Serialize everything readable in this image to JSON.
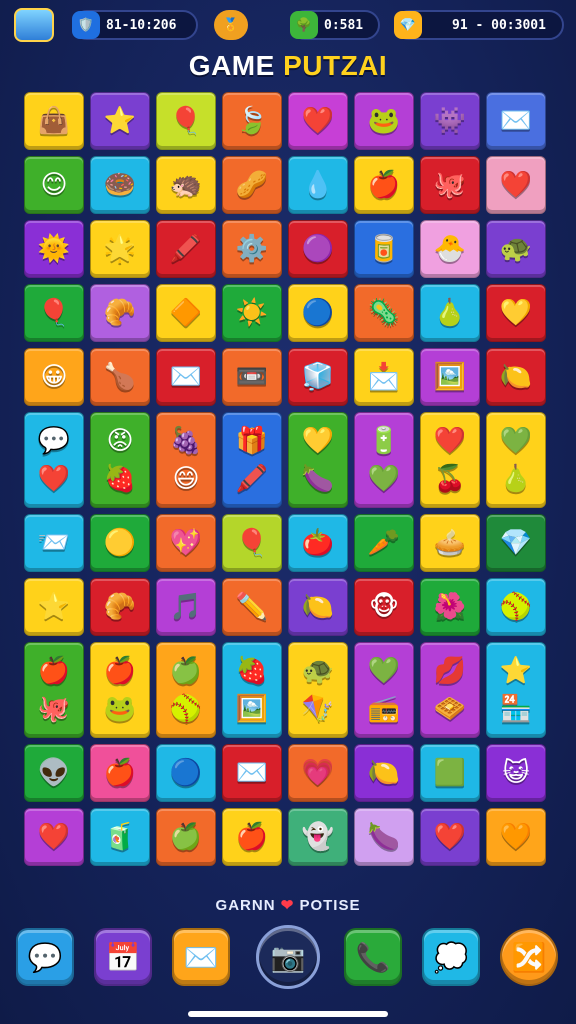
{
  "topbar": {
    "logo_text": "",
    "stat1": {
      "icon": "shield-icon",
      "value": "81-10:206",
      "color": "#1f6fe0"
    },
    "stat2": {
      "icon": "badge-icon",
      "color": "#f0a020"
    },
    "stat3": {
      "icon": "bush-icon",
      "value": "0:581",
      "color": "#3db53a"
    },
    "stat4": {
      "icon": "gem-icon",
      "value": "91 - 00:3001",
      "color": "#ffb31a"
    }
  },
  "title": {
    "word1": "GAME",
    "word2": "PUTZAI"
  },
  "grid": {
    "rows": [
      [
        {
          "c": "#ffd21a",
          "g": "👜",
          "n": "bag-icon"
        },
        {
          "c": "#7a3fd0",
          "g": "⭐",
          "n": "star-icon"
        },
        {
          "c": "#c6e02a",
          "g": "🎈",
          "n": "balloon-icon"
        },
        {
          "c": "#f26a2a",
          "g": "🍃",
          "n": "leaf-icon"
        },
        {
          "c": "#c73fd6",
          "g": "❤️",
          "n": "heart-icon"
        },
        {
          "c": "#b43fd6",
          "g": "🐸",
          "n": "frog-icon"
        },
        {
          "c": "#7a3fd0",
          "g": "👾",
          "n": "monster-icon"
        },
        {
          "c": "#4a6fe0",
          "g": "✉️",
          "n": "envelope-icon"
        }
      ],
      [
        {
          "c": "#3fb02a",
          "g": "😊",
          "n": "smiley-icon"
        },
        {
          "c": "#1fb8e6",
          "g": "🍩",
          "n": "donut-icon"
        },
        {
          "c": "#ffd21a",
          "g": "🦔",
          "n": "spiky-icon"
        },
        {
          "c": "#f26a2a",
          "g": "🥜",
          "n": "peanut-icon"
        },
        {
          "c": "#1fb8e6",
          "g": "💧",
          "n": "drop-icon"
        },
        {
          "c": "#ffd21a",
          "g": "🍎",
          "n": "apple-icon"
        },
        {
          "c": "#d81f2a",
          "g": "🐙",
          "n": "octopus-icon"
        },
        {
          "c": "#f0a0c0",
          "g": "❤️",
          "n": "heart-icon"
        }
      ],
      [
        {
          "c": "#8a2fd6",
          "g": "🌞",
          "n": "sun-icon"
        },
        {
          "c": "#ffd21a",
          "g": "🌟",
          "n": "sunflower-icon"
        },
        {
          "c": "#d81f2a",
          "g": "🖍️",
          "n": "crayon-icon"
        },
        {
          "c": "#f26a2a",
          "g": "⚙️",
          "n": "gear-icon"
        },
        {
          "c": "#d81f2a",
          "g": "🟣",
          "n": "purple-ball-icon"
        },
        {
          "c": "#2a6fe0",
          "g": "🥫",
          "n": "jar-icon"
        },
        {
          "c": "#f0a0e0",
          "g": "🐣",
          "n": "chick-icon"
        },
        {
          "c": "#7a3fd0",
          "g": "🐢",
          "n": "turtle-icon"
        }
      ],
      [
        {
          "c": "#1faa3a",
          "g": "🎈",
          "n": "balloon-icon"
        },
        {
          "c": "#b060e0",
          "g": "🥐",
          "n": "croissant-icon"
        },
        {
          "c": "#ffd21a",
          "g": "🔶",
          "n": "diamond-icon"
        },
        {
          "c": "#1faa3a",
          "g": "☀️",
          "n": "sun-icon"
        },
        {
          "c": "#ffd21a",
          "g": "🔵",
          "n": "blue-ball-icon"
        },
        {
          "c": "#f26a2a",
          "g": "🦠",
          "n": "germ-icon"
        },
        {
          "c": "#1fb8e6",
          "g": "🍐",
          "n": "pear-icon"
        },
        {
          "c": "#d81f2a",
          "g": "💛",
          "n": "heart-icon"
        }
      ],
      [
        {
          "c": "#ffa51a",
          "g": "😀",
          "n": "smiley-icon"
        },
        {
          "c": "#f26a2a",
          "g": "🍗",
          "n": "drumstick-icon"
        },
        {
          "c": "#d81f2a",
          "g": "✉️",
          "n": "envelope-icon"
        },
        {
          "c": "#f26a2a",
          "g": "📼",
          "n": "tape-icon"
        },
        {
          "c": "#d81f2a",
          "g": "🧊",
          "n": "cube-icon"
        },
        {
          "c": "#ffd21a",
          "g": "📩",
          "n": "envelope-icon"
        },
        {
          "c": "#b43fd6",
          "g": "🖼️",
          "n": "picture-icon"
        },
        {
          "c": "#d81f2a",
          "g": "🍋",
          "n": "lemon-icon"
        }
      ]
    ],
    "tall_row": [
      {
        "c": "#1fb8e6",
        "g": [
          "💬",
          "❤️"
        ],
        "n": "speech-heart-tile"
      },
      {
        "c": "#3fb02a",
        "g": [
          "😡",
          "🍓"
        ],
        "n": "face-strawberry-tile"
      },
      {
        "c": "#f26a2a",
        "g": [
          "🍇",
          "😄"
        ],
        "n": "grape-sun-tile"
      },
      {
        "c": "#2a6fe0",
        "g": [
          "🎁",
          "🖍️"
        ],
        "n": "gift-crayon-tile"
      },
      {
        "c": "#3fb02a",
        "g": [
          "💛",
          "🍆"
        ],
        "n": "heart-eggplant-tile"
      },
      {
        "c": "#b43fd6",
        "g": [
          "🔋",
          "💚"
        ],
        "n": "battery-disc-tile"
      },
      {
        "c": "#ffd21a",
        "g": [
          "❤️",
          "🍒"
        ],
        "n": "heart-cherry-tile"
      },
      {
        "c": "#ffd21a",
        "g": [
          "💚",
          "🍐"
        ],
        "n": "heart-pear-tile"
      }
    ],
    "rows2": [
      [
        {
          "c": "#1fb8e6",
          "g": "📨",
          "n": "envelope-icon"
        },
        {
          "c": "#1faa3a",
          "g": "🟡",
          "n": "yellow-balloon-icon"
        },
        {
          "c": "#f26a2a",
          "g": "💖",
          "n": "heart-icon"
        },
        {
          "c": "#b4d62a",
          "g": "🎈",
          "n": "balloon-icon"
        },
        {
          "c": "#1fb8e6",
          "g": "🍅",
          "n": "tomato-icon"
        },
        {
          "c": "#1faa3a",
          "g": "🥕",
          "n": "carrot-icon"
        },
        {
          "c": "#ffd21a",
          "g": "🥧",
          "n": "pie-icon"
        },
        {
          "c": "#1f8a3a",
          "g": "💎",
          "n": "diamond-icon"
        }
      ],
      [
        {
          "c": "#ffd21a",
          "g": "⭐",
          "n": "star-icon"
        },
        {
          "c": "#d81f2a",
          "g": "🥐",
          "n": "croissant-icon"
        },
        {
          "c": "#b43fd6",
          "g": "🎵",
          "n": "music-icon"
        },
        {
          "c": "#f26a2a",
          "g": "✏️",
          "n": "pencil-icon"
        },
        {
          "c": "#7a3fd0",
          "g": "🍋",
          "n": "lemon-icon"
        },
        {
          "c": "#d81f2a",
          "g": "🐵",
          "n": "monkey-icon"
        },
        {
          "c": "#1faa3a",
          "g": "🌺",
          "n": "flower-icon"
        },
        {
          "c": "#1fb8e6",
          "g": "🥎",
          "n": "ball-icon"
        }
      ]
    ],
    "tall_row2": [
      {
        "c": "#3fb02a",
        "g": [
          "🍎",
          "🐙"
        ],
        "n": "apple-blob-tile"
      },
      {
        "c": "#ffd21a",
        "g": [
          "🍎",
          "🐸"
        ],
        "n": "apple-frog-tile"
      },
      {
        "c": "#ffa51a",
        "g": [
          "🍏",
          "🥎"
        ],
        "n": "apple-ball-tile"
      },
      {
        "c": "#1fb8e6",
        "g": [
          "🍓",
          "🖼️"
        ],
        "n": "strawberry-frame-tile"
      },
      {
        "c": "#ffd21a",
        "g": [
          "🐢",
          "🪁"
        ],
        "n": "turtle-kite-tile"
      },
      {
        "c": "#b43fd6",
        "g": [
          "💚",
          "📻"
        ],
        "n": "heart-radio-tile"
      },
      {
        "c": "#b43fd6",
        "g": [
          "💋",
          "🧇"
        ],
        "n": "lips-waffle-tile"
      },
      {
        "c": "#1fb8e6",
        "g": [
          "⭐",
          "🏪"
        ],
        "n": "star-shop-tile"
      }
    ],
    "rows3": [
      [
        {
          "c": "#1faa3a",
          "g": "👽",
          "n": "alien-icon"
        },
        {
          "c": "#f0509a",
          "g": "🍎",
          "n": "apple-icon"
        },
        {
          "c": "#1fb8e6",
          "g": "🔵",
          "n": "blue-ball-icon"
        },
        {
          "c": "#d81f2a",
          "g": "✉️",
          "n": "envelope-icon"
        },
        {
          "c": "#f26a2a",
          "g": "💗",
          "n": "heart-icon"
        },
        {
          "c": "#8a2fd6",
          "g": "🍋",
          "n": "lemon-icon"
        },
        {
          "c": "#1fb8e6",
          "g": "🟩",
          "n": "diamond-icon"
        },
        {
          "c": "#8a2fd6",
          "g": "😺",
          "n": "cat-icon"
        }
      ],
      [
        {
          "c": "#b43fd6",
          "g": "❤️",
          "n": "heart-icon"
        },
        {
          "c": "#1fb8e6",
          "g": "🧃",
          "n": "juice-icon"
        },
        {
          "c": "#f26a2a",
          "g": "🍏",
          "n": "apple-icon"
        },
        {
          "c": "#ffd21a",
          "g": "🍎",
          "n": "apple-icon"
        },
        {
          "c": "#3fb07a",
          "g": "👻",
          "n": "ghost-icon"
        },
        {
          "c": "#d0a0f0",
          "g": "🍆",
          "n": "eggplant-icon"
        },
        {
          "c": "#7a3fd0",
          "g": "❤️",
          "n": "heart-icon"
        },
        {
          "c": "#ffa51a",
          "g": "🧡",
          "n": "heart-icon"
        }
      ]
    ]
  },
  "footer": {
    "left": "GARNN",
    "right": "POTISE"
  },
  "dock": [
    {
      "n": "chat-icon",
      "g": "💬",
      "c": "#2a9fe6"
    },
    {
      "n": "calendar-icon",
      "g": "📅",
      "c": "#7a3fd0"
    },
    {
      "n": "mail-icon",
      "g": "✉️",
      "c": "#ffa51a"
    },
    {
      "n": "camera-icon",
      "g": "📷",
      "c": "#1c2a5a"
    },
    {
      "n": "phone-icon",
      "g": "📞",
      "c": "#2aaa3a"
    },
    {
      "n": "message-icon",
      "g": "💭",
      "c": "#1fb8e6"
    },
    {
      "n": "share-icon",
      "g": "🔀",
      "c": "#ff9a1a"
    }
  ]
}
